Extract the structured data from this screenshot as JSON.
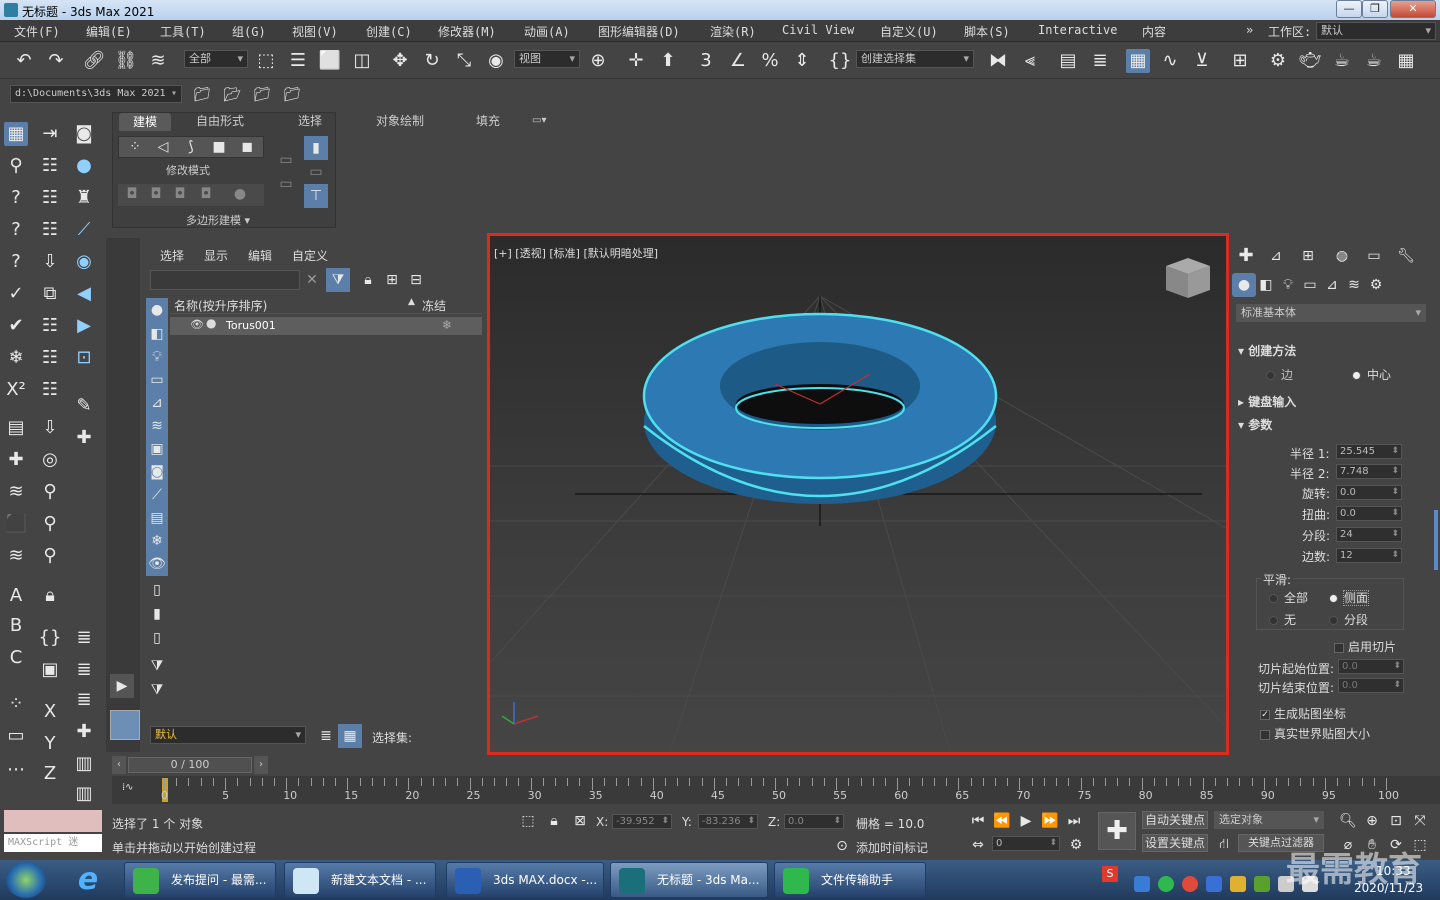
{
  "window": {
    "title": "无标题 - 3ds Max 2021"
  },
  "menu": [
    "文件(F)",
    "编辑(E)",
    "工具(T)",
    "组(G)",
    "视图(V)",
    "创建(C)",
    "修改器(M)",
    "动画(A)",
    "图形编辑器(D)",
    "渲染(R)",
    "Civil View",
    "自定义(U)",
    "脚本(S)",
    "Interactive",
    "内容"
  ],
  "workspace": {
    "label": "工作区:",
    "value": "默认"
  },
  "toolbar": {
    "filter": "全部",
    "refcoord": "视图",
    "selset": "创建选择集"
  },
  "path": {
    "project": "d:\\Documents\\3ds Max 2021"
  },
  "ribbon": {
    "tabs": [
      "建模",
      "自由形式",
      "选择",
      "对象绘制",
      "填充"
    ],
    "modify_mode": "修改模式",
    "poly_modeling": "多边形建模"
  },
  "scene_explorer": {
    "tabs": [
      "选择",
      "显示",
      "编辑",
      "自定义"
    ],
    "col_name": "名称(按升序排序)",
    "col_freeze": "冻结",
    "object": "Torus001",
    "layer": "默认",
    "selset_label": "选择集:"
  },
  "viewport": {
    "label": "[+] [透视] [标准] [默认明暗处理]"
  },
  "command_panel": {
    "category": "标准基本体",
    "creation_method": {
      "title": "创建方法",
      "edge": "边",
      "center": "中心"
    },
    "keyboard_entry": "键盘输入",
    "params": {
      "title": "参数",
      "radius1_label": "半径 1:",
      "radius1": "25.545",
      "radius2_label": "半径 2:",
      "radius2": "7.748",
      "rotation_label": "旋转:",
      "rotation": "0.0",
      "twist_label": "扭曲:",
      "twist": "0.0",
      "segments_label": "分段:",
      "segments": "24",
      "sides_label": "边数:",
      "sides": "12"
    },
    "smooth": {
      "title": "平滑:",
      "all": "全部",
      "sides": "侧面",
      "none": "无",
      "segment": "分段"
    },
    "slice_on": "启用切片",
    "slice_from_label": "切片起始位置:",
    "slice_from": "0.0",
    "slice_to_label": "切片结束位置:",
    "slice_to": "0.0",
    "gen_map": "生成贴图坐标",
    "real_world": "真实世界贴图大小"
  },
  "timeline": {
    "frame": "0 / 100",
    "ticks": [
      "0",
      "5",
      "10",
      "15",
      "20",
      "25",
      "30",
      "35",
      "40",
      "45",
      "50",
      "55",
      "60",
      "65",
      "70",
      "75",
      "80",
      "85",
      "90",
      "95",
      "100"
    ]
  },
  "status": {
    "maxscript": "MAXScript 迷",
    "selected": "选择了 1 个 对象",
    "prompt": "单击并拖动以开始创建过程",
    "x_label": "X:",
    "x": "-39.952",
    "y_label": "Y:",
    "y": "-83.236",
    "z_label": "Z:",
    "z": "0.0",
    "grid": "栅格 = 10.0",
    "add_time_tag": "添加时间标记",
    "auto_key": "自动关键点",
    "set_key": "设置关键点",
    "sel_obj": "选定对象",
    "key_filter": "关键点过滤器",
    "frame_val": "0"
  },
  "taskbar": {
    "items": [
      "发布提问 - 最需...",
      "新建文本文档 - ...",
      "3ds MAX.docx -...",
      "无标题 - 3ds Ma...",
      "文件传输助手"
    ],
    "time": "10:33",
    "date": "2020/11/23",
    "watermark": "最需教育"
  }
}
